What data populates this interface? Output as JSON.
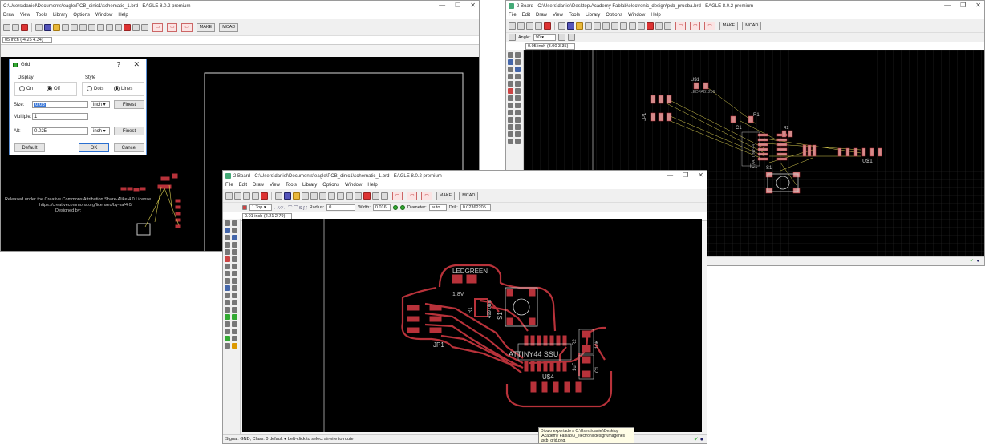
{
  "win1": {
    "title": "C:\\Users\\daniel\\Documents\\eagle\\PCB_dinic1\\schematic_1.brd - EAGLE 8.0.2 premium",
    "menu": [
      "Draw",
      "View",
      "Tools",
      "Library",
      "Options",
      "Window",
      "Help"
    ],
    "buttons": [
      "MAKE",
      "MCAD"
    ],
    "coord": "05 inch (-4.25 4.34)",
    "license_text": [
      "Released under the Creative Commons Attribution Share-Alike 4.0 License",
      "https://creativecommons.org/licenses/by-sa/4.0/",
      "Designed by:"
    ],
    "grid_dialog": {
      "title": "Grid",
      "help": "?",
      "close": "✕",
      "display_label": "Display",
      "style_label": "Style",
      "display_on": "On",
      "display_off": "Off",
      "style_dots": "Dots",
      "style_lines": "Lines",
      "size_label": "Size:",
      "size_value": "0.05",
      "size_unit": "inch",
      "multiple_label": "Multiple:",
      "multiple_value": "1",
      "alt_label": "Alt:",
      "alt_value": "0.025",
      "alt_unit": "inch",
      "finest": "Finest",
      "default_btn": "Default",
      "ok_btn": "OK",
      "cancel_btn": "Cancel"
    }
  },
  "win2": {
    "title": "2 Board - C:\\Users\\daniel\\Desktop\\Academy Fablab\\electronic_design\\pcb_prueba.brd - EAGLE 8.0.2 premium",
    "menu": [
      "File",
      "Edit",
      "Draw",
      "View",
      "Tools",
      "Library",
      "Options",
      "Window",
      "Help"
    ],
    "buttons": [
      "MAKE",
      "MCAD"
    ],
    "angle_label": "Angle:",
    "angle_value": "90",
    "coord": "0.05 inch (3.00 3.35)",
    "labels": {
      "u1": "U$1",
      "u1_sub": "LEDFAB1206",
      "jp1": "JP1",
      "r1": "R1",
      "c1": "C1",
      "ic1": "IC1",
      "r2": "R2",
      "s1": "S1",
      "u2": "U$1",
      "attiny": "ATTINY44"
    }
  },
  "win3": {
    "title": "2 Board - C:\\Users\\daniel\\Documents\\eagle\\PCB_dinic1\\schematic_1.brd - EAGLE 8.0.2 premium",
    "menu": [
      "File",
      "Edit",
      "Draw",
      "View",
      "Tools",
      "Library",
      "Options",
      "Window",
      "Help"
    ],
    "buttons": [
      "MAKE",
      "MCAD"
    ],
    "layer_value": "1 Top",
    "radius_label": "Radius:",
    "radius_value": "0",
    "width_label": "Width:",
    "width_value": "0.016",
    "diameter_label": "Diameter:",
    "diameter_value": "auto",
    "drill_label": "Drill:",
    "drill_value": "0.02362205",
    "coord": "0.01 inch (2.21 2.79)",
    "status": "Signal: GND, Class: 0 default  ● Left-click to select airwire to route",
    "tooltip": [
      "Dibujo exportado a C:\\Users\\daniel\\Desktop",
      "\\Academy Fablab\\3_electronicdesign\\imagenes",
      "\\pcb_grid.png."
    ],
    "pcb": {
      "ledgreen": "LEDGREEN",
      "led_val": "1.8V",
      "r_val": "499 ohm",
      "r_ref": "R1",
      "s1": "S1",
      "jp1": "JP1",
      "attiny": "ATTINY44 SSU",
      "u4": "U$4",
      "r10k": "10K",
      "r2": "R2",
      "c1": "C1",
      "c_val": "1uF"
    }
  },
  "colors": {
    "copper": "#b8323a",
    "silk": "#d0d0d0",
    "airwire": "#d8cc50",
    "grid": "#2a2a2a"
  }
}
